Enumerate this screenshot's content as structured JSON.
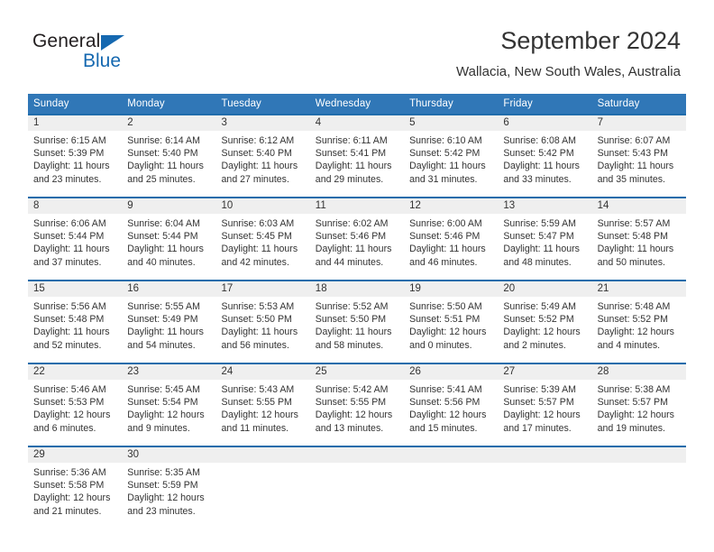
{
  "brand": {
    "name_part1": "General",
    "name_part2": "Blue",
    "logo_icon": "triangle-flag-icon",
    "accent_color": "#1568b0"
  },
  "header": {
    "title": "September 2024",
    "subtitle": "Wallacia, New South Wales, Australia"
  },
  "calendar": {
    "header_bg": "#3077b7",
    "row_divider_color": "#1f6cab",
    "daynum_band_bg": "#efefef",
    "day_names": [
      "Sunday",
      "Monday",
      "Tuesday",
      "Wednesday",
      "Thursday",
      "Friday",
      "Saturday"
    ],
    "weeks": [
      {
        "days": [
          {
            "num": "1",
            "sunrise": "Sunrise: 6:15 AM",
            "sunset": "Sunset: 5:39 PM",
            "daylight": "Daylight: 11 hours and 23 minutes."
          },
          {
            "num": "2",
            "sunrise": "Sunrise: 6:14 AM",
            "sunset": "Sunset: 5:40 PM",
            "daylight": "Daylight: 11 hours and 25 minutes."
          },
          {
            "num": "3",
            "sunrise": "Sunrise: 6:12 AM",
            "sunset": "Sunset: 5:40 PM",
            "daylight": "Daylight: 11 hours and 27 minutes."
          },
          {
            "num": "4",
            "sunrise": "Sunrise: 6:11 AM",
            "sunset": "Sunset: 5:41 PM",
            "daylight": "Daylight: 11 hours and 29 minutes."
          },
          {
            "num": "5",
            "sunrise": "Sunrise: 6:10 AM",
            "sunset": "Sunset: 5:42 PM",
            "daylight": "Daylight: 11 hours and 31 minutes."
          },
          {
            "num": "6",
            "sunrise": "Sunrise: 6:08 AM",
            "sunset": "Sunset: 5:42 PM",
            "daylight": "Daylight: 11 hours and 33 minutes."
          },
          {
            "num": "7",
            "sunrise": "Sunrise: 6:07 AM",
            "sunset": "Sunset: 5:43 PM",
            "daylight": "Daylight: 11 hours and 35 minutes."
          }
        ]
      },
      {
        "days": [
          {
            "num": "8",
            "sunrise": "Sunrise: 6:06 AM",
            "sunset": "Sunset: 5:44 PM",
            "daylight": "Daylight: 11 hours and 37 minutes."
          },
          {
            "num": "9",
            "sunrise": "Sunrise: 6:04 AM",
            "sunset": "Sunset: 5:44 PM",
            "daylight": "Daylight: 11 hours and 40 minutes."
          },
          {
            "num": "10",
            "sunrise": "Sunrise: 6:03 AM",
            "sunset": "Sunset: 5:45 PM",
            "daylight": "Daylight: 11 hours and 42 minutes."
          },
          {
            "num": "11",
            "sunrise": "Sunrise: 6:02 AM",
            "sunset": "Sunset: 5:46 PM",
            "daylight": "Daylight: 11 hours and 44 minutes."
          },
          {
            "num": "12",
            "sunrise": "Sunrise: 6:00 AM",
            "sunset": "Sunset: 5:46 PM",
            "daylight": "Daylight: 11 hours and 46 minutes."
          },
          {
            "num": "13",
            "sunrise": "Sunrise: 5:59 AM",
            "sunset": "Sunset: 5:47 PM",
            "daylight": "Daylight: 11 hours and 48 minutes."
          },
          {
            "num": "14",
            "sunrise": "Sunrise: 5:57 AM",
            "sunset": "Sunset: 5:48 PM",
            "daylight": "Daylight: 11 hours and 50 minutes."
          }
        ]
      },
      {
        "days": [
          {
            "num": "15",
            "sunrise": "Sunrise: 5:56 AM",
            "sunset": "Sunset: 5:48 PM",
            "daylight": "Daylight: 11 hours and 52 minutes."
          },
          {
            "num": "16",
            "sunrise": "Sunrise: 5:55 AM",
            "sunset": "Sunset: 5:49 PM",
            "daylight": "Daylight: 11 hours and 54 minutes."
          },
          {
            "num": "17",
            "sunrise": "Sunrise: 5:53 AM",
            "sunset": "Sunset: 5:50 PM",
            "daylight": "Daylight: 11 hours and 56 minutes."
          },
          {
            "num": "18",
            "sunrise": "Sunrise: 5:52 AM",
            "sunset": "Sunset: 5:50 PM",
            "daylight": "Daylight: 11 hours and 58 minutes."
          },
          {
            "num": "19",
            "sunrise": "Sunrise: 5:50 AM",
            "sunset": "Sunset: 5:51 PM",
            "daylight": "Daylight: 12 hours and 0 minutes."
          },
          {
            "num": "20",
            "sunrise": "Sunrise: 5:49 AM",
            "sunset": "Sunset: 5:52 PM",
            "daylight": "Daylight: 12 hours and 2 minutes."
          },
          {
            "num": "21",
            "sunrise": "Sunrise: 5:48 AM",
            "sunset": "Sunset: 5:52 PM",
            "daylight": "Daylight: 12 hours and 4 minutes."
          }
        ]
      },
      {
        "days": [
          {
            "num": "22",
            "sunrise": "Sunrise: 5:46 AM",
            "sunset": "Sunset: 5:53 PM",
            "daylight": "Daylight: 12 hours and 6 minutes."
          },
          {
            "num": "23",
            "sunrise": "Sunrise: 5:45 AM",
            "sunset": "Sunset: 5:54 PM",
            "daylight": "Daylight: 12 hours and 9 minutes."
          },
          {
            "num": "24",
            "sunrise": "Sunrise: 5:43 AM",
            "sunset": "Sunset: 5:55 PM",
            "daylight": "Daylight: 12 hours and 11 minutes."
          },
          {
            "num": "25",
            "sunrise": "Sunrise: 5:42 AM",
            "sunset": "Sunset: 5:55 PM",
            "daylight": "Daylight: 12 hours and 13 minutes."
          },
          {
            "num": "26",
            "sunrise": "Sunrise: 5:41 AM",
            "sunset": "Sunset: 5:56 PM",
            "daylight": "Daylight: 12 hours and 15 minutes."
          },
          {
            "num": "27",
            "sunrise": "Sunrise: 5:39 AM",
            "sunset": "Sunset: 5:57 PM",
            "daylight": "Daylight: 12 hours and 17 minutes."
          },
          {
            "num": "28",
            "sunrise": "Sunrise: 5:38 AM",
            "sunset": "Sunset: 5:57 PM",
            "daylight": "Daylight: 12 hours and 19 minutes."
          }
        ]
      },
      {
        "days": [
          {
            "num": "29",
            "sunrise": "Sunrise: 5:36 AM",
            "sunset": "Sunset: 5:58 PM",
            "daylight": "Daylight: 12 hours and 21 minutes."
          },
          {
            "num": "30",
            "sunrise": "Sunrise: 5:35 AM",
            "sunset": "Sunset: 5:59 PM",
            "daylight": "Daylight: 12 hours and 23 minutes."
          },
          {
            "num": "",
            "sunrise": "",
            "sunset": "",
            "daylight": ""
          },
          {
            "num": "",
            "sunrise": "",
            "sunset": "",
            "daylight": ""
          },
          {
            "num": "",
            "sunrise": "",
            "sunset": "",
            "daylight": ""
          },
          {
            "num": "",
            "sunrise": "",
            "sunset": "",
            "daylight": ""
          },
          {
            "num": "",
            "sunrise": "",
            "sunset": "",
            "daylight": ""
          }
        ]
      }
    ]
  }
}
